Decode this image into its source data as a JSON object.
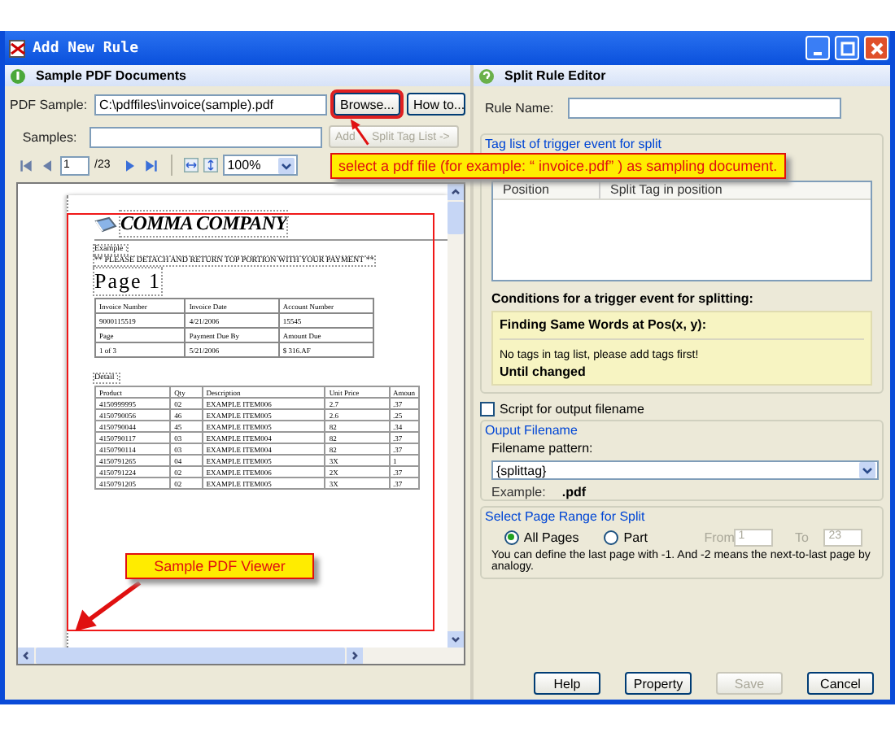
{
  "window": {
    "title": "Add New Rule"
  },
  "left_panel": {
    "title": "Sample PDF Documents",
    "pdf_sample": {
      "label": "PDF Sample:",
      "value": "C:\\pdffiles\\invoice(sample).pdf"
    },
    "browse_button": "Browse...",
    "howto_button": "How to...",
    "samples": {
      "label": "Samples:"
    },
    "add_button": {
      "label_parts": [
        "Add",
        "Split Tag List ->"
      ],
      "disabled": true
    },
    "pager": {
      "page": "1",
      "total": "/23",
      "zoom": "100%"
    },
    "document": {
      "company": "COMMA COMPANY",
      "example": "Example :",
      "notice": "** PLEASE DETACH AND RETURN TOP PORTION WITH YOUR PAYMENT **",
      "page_title": "Page 1",
      "info_rows": [
        [
          "Invoice Number",
          "Invoice Date",
          "Account Number"
        ],
        [
          "9000115519",
          "4/21/2006",
          "15545"
        ],
        [
          "Page",
          "Payment Due By",
          "Amount Due"
        ],
        [
          "1 of 3",
          "5/21/2006",
          "$ 316.AF"
        ]
      ],
      "detail_label": "Detail :",
      "detail_columns": [
        "Product",
        "Qty",
        "Description",
        "Unit Price",
        "Amoun"
      ],
      "detail_rows": [
        [
          "4150999995",
          "02",
          "EXAMPLE ITEM006",
          "2.7",
          ".37"
        ],
        [
          "4150790056",
          "46",
          "EXAMPLE ITEM005",
          "2.6",
          ".25"
        ],
        [
          "4150790044",
          "45",
          "EXAMPLE ITEM005",
          "82",
          ".34"
        ],
        [
          "4150790117",
          "03",
          "EXAMPLE ITEM004",
          "82",
          ".37"
        ],
        [
          "4150790114",
          "03",
          "EXAMPLE ITEM004",
          "82",
          ".37"
        ],
        [
          "4150791265",
          "04",
          "EXAMPLE ITEM005",
          "3X",
          "1"
        ],
        [
          "4150791224",
          "02",
          "EXAMPLE ITEM006",
          "2X",
          ".37"
        ],
        [
          "4150791205",
          "02",
          "EXAMPLE ITEM005",
          "3X",
          ".37"
        ]
      ]
    }
  },
  "right_panel": {
    "title": "Split Rule Editor",
    "rule_name": {
      "label": "Rule Name:"
    },
    "tag_group": {
      "title": "Tag list of trigger event for split",
      "columns": [
        "Position",
        "Split Tag in position"
      ]
    },
    "conditions": {
      "title": "Conditions for a trigger event for splitting:",
      "heading": "Finding Same Words at Pos(x, y):",
      "message": "No tags in tag list, please add tags first!",
      "footer": "Until changed"
    },
    "script_checkbox": {
      "label": "Script for output filename",
      "checked": false
    },
    "output_group": {
      "title": "Ouput Filename",
      "pattern_label": "Filename pattern:",
      "pattern": "{splittag}",
      "example_label": "Example:",
      "example_value": ".pdf"
    },
    "range_group": {
      "title": "Select Page Range for Split",
      "options": [
        {
          "label": "All Pages",
          "selected": true
        },
        {
          "label": "Part",
          "selected": false
        }
      ],
      "from": {
        "label": "From",
        "value": "1",
        "disabled": true
      },
      "to": {
        "label": "To",
        "value": "23",
        "disabled": true
      },
      "note": "You can define the last page with -1. And -2 means the next-to-last page by analogy."
    },
    "buttons": [
      {
        "label": "Help",
        "disabled": false
      },
      {
        "label": "Property",
        "disabled": false
      },
      {
        "label": "Save",
        "disabled": true
      },
      {
        "label": "Cancel",
        "disabled": false
      }
    ]
  },
  "callouts": [
    {
      "text": "select a pdf file (for example: “ invoice.pdf” ) as sampling document."
    },
    {
      "text": "Sample PDF Viewer"
    }
  ]
}
